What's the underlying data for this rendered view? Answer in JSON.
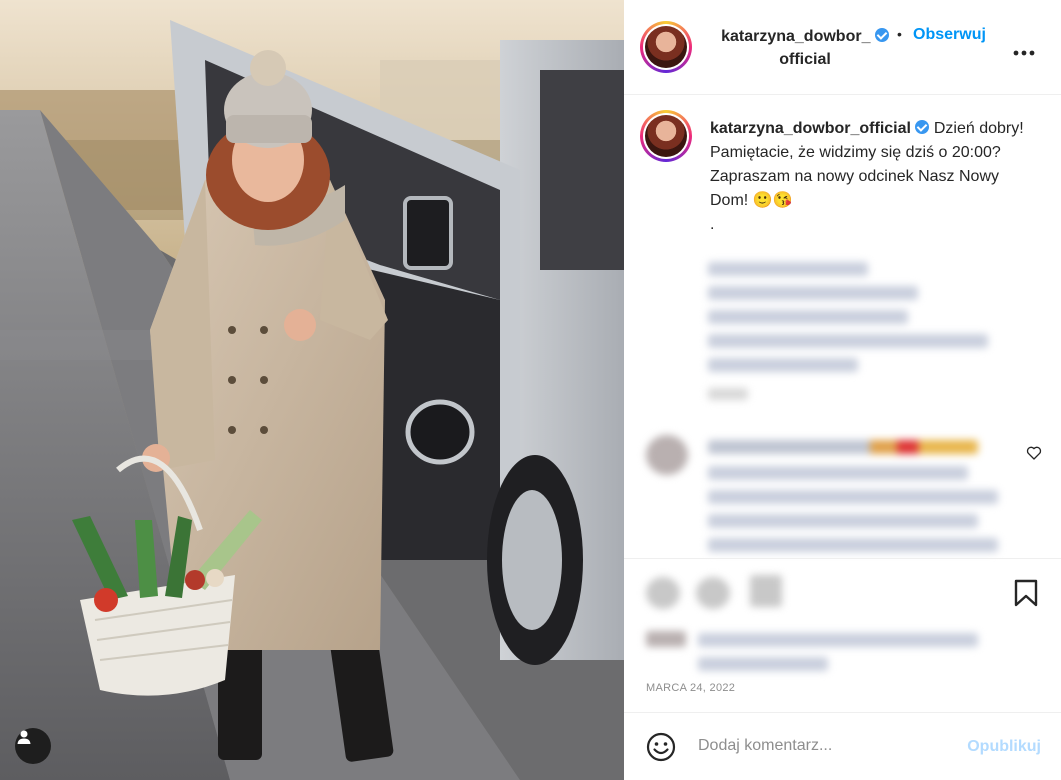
{
  "post": {
    "author": {
      "username_line1": "katarzyna_dowbor_",
      "username_line2": "official",
      "username_full": "katarzyna_dowbor_official",
      "verified": true
    },
    "follow_label": "Obserwuj",
    "separator": "•",
    "more_label": "•••",
    "caption_text": "Dzień dobry! Pamiętacie, że widzimy się dziś o 20:00? Zapraszam na nowy odcinek Nasz Nowy Dom! 🙂😘",
    "caption_dot": ".",
    "date": "MARCA 24, 2022",
    "comment_placeholder": "Dodaj komentarz...",
    "publish_label": "Opublikuj"
  },
  "colors": {
    "accent": "#0095f6",
    "publish_disabled": "#b3dbff",
    "verified": "#3897f0",
    "text": "#262626",
    "muted": "#8e8e8e"
  },
  "icons": {
    "more": "more-dots-icon",
    "user_tag": "user-tag-icon",
    "heart": "heart-icon",
    "bookmark": "bookmark-icon",
    "emoji": "emoji-icon"
  }
}
